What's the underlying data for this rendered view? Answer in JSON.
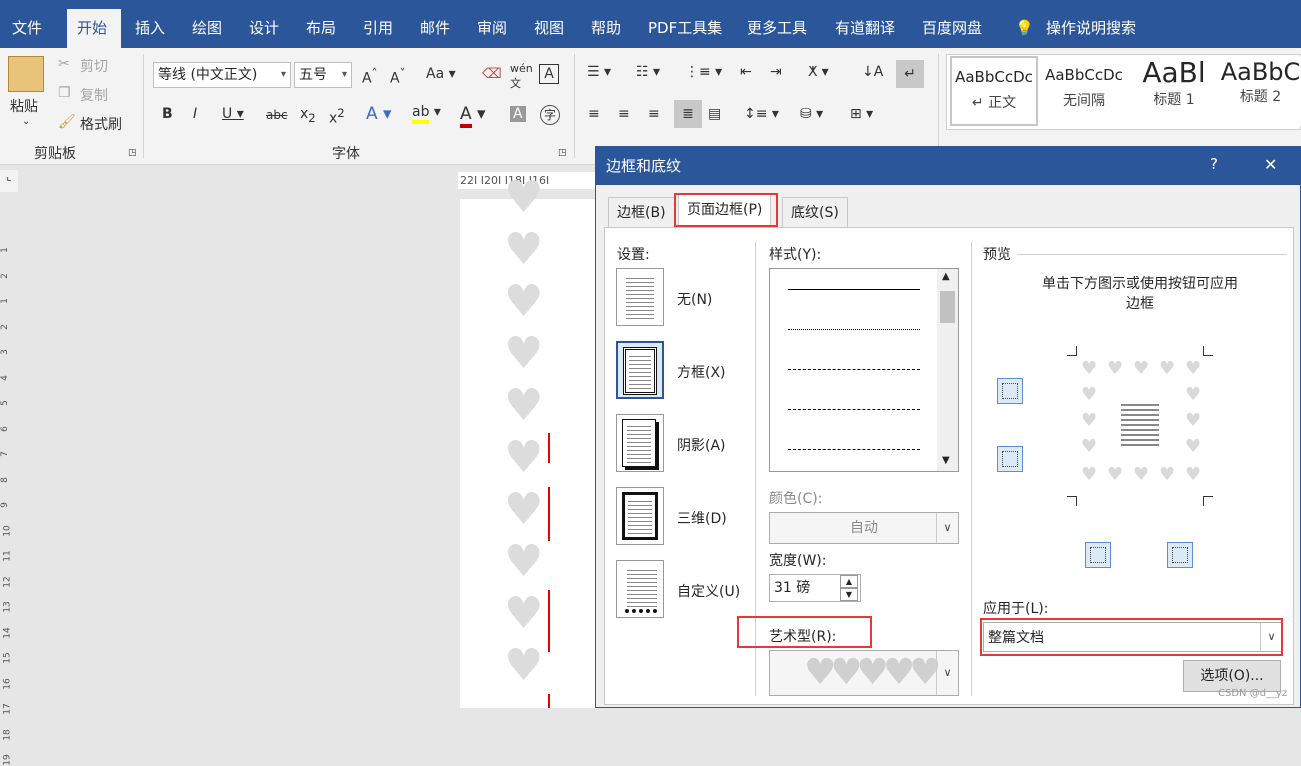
{
  "menu": {
    "tabs": [
      "文件",
      "开始",
      "插入",
      "绘图",
      "设计",
      "布局",
      "引用",
      "邮件",
      "审阅",
      "视图",
      "帮助",
      "PDF工具集",
      "更多工具",
      "有道翻译",
      "百度网盘"
    ],
    "active_tab": "开始",
    "search_label": "操作说明搜索"
  },
  "ribbon": {
    "clipboard": {
      "paste": "粘贴",
      "cut": "剪切",
      "copy": "复制",
      "format_painter": "格式刷",
      "group_label": "剪贴板"
    },
    "font": {
      "font_name": "等线 (中文正文)",
      "font_size": "五号",
      "group_label": "字体"
    },
    "styles": [
      {
        "preview": "AaBbCcDc",
        "name": "↵ 正文"
      },
      {
        "preview": "AaBbCcDc",
        "name": "无间隔"
      },
      {
        "preview": "AaBl",
        "name": "标题 1"
      },
      {
        "preview": "AaBbC",
        "name": "标题 2"
      }
    ]
  },
  "ruler": {
    "marks": "22I  I20I  I18I  I16I"
  },
  "dialog": {
    "title": "边框和底纹",
    "help": "?",
    "close": "✕",
    "tabs": [
      "边框(B)",
      "页面边框(P)",
      "底纹(S)"
    ],
    "active_tab": "页面边框(P)",
    "settings_label": "设置:",
    "settings": [
      "无(N)",
      "方框(X)",
      "阴影(A)",
      "三维(D)",
      "自定义(U)"
    ],
    "style_label": "样式(Y):",
    "color_label": "颜色(C):",
    "color_value": "自动",
    "width_label": "宽度(W):",
    "width_value": "31 磅",
    "art_label": "艺术型(R):",
    "preview_label": "预览",
    "preview_hint": "单击下方图示或使用按钮可应用边框",
    "apply_label": "应用于(L):",
    "apply_value": "整篇文档",
    "options_button": "选项(O)..."
  },
  "vruler_numbers": [
    "1",
    "2",
    "1",
    "2",
    "3",
    "4",
    "5",
    "6",
    "7",
    "8",
    "9",
    "10",
    "11",
    "12",
    "13",
    "14",
    "15",
    "16",
    "17",
    "18",
    "19"
  ],
  "watermark": "CSDN @d__yz"
}
